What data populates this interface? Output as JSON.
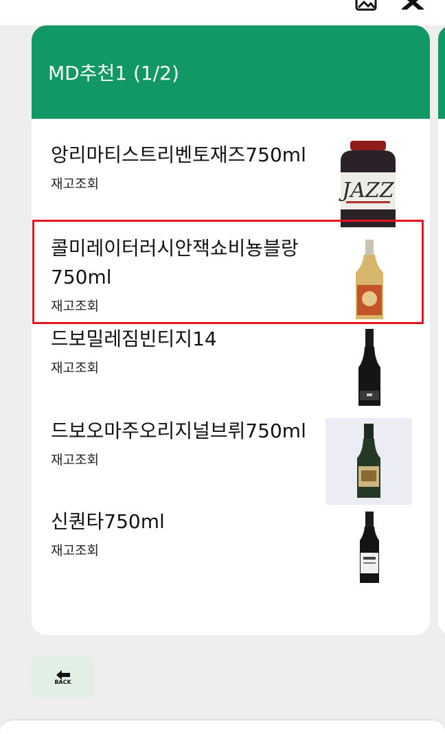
{
  "card": {
    "title": "MD추천1 (1/2)"
  },
  "products": [
    {
      "name": "앙리마티스트리벤토재즈750ml",
      "stock_label": "재고조회",
      "image": "jazz-bottle"
    },
    {
      "name": "콜미레이터러시안잭쇼비뇽블랑750ml",
      "stock_label": "재고조회",
      "image": "white-wine-bottle"
    },
    {
      "name": "드보밀레짐빈티지14",
      "stock_label": "재고조회",
      "image": "champagne-bottle-dark"
    },
    {
      "name": "드보오마주오리지널브뤼750ml",
      "stock_label": "재고조회",
      "image": "champagne-bottle-green"
    },
    {
      "name": "신퀀타750ml",
      "stock_label": "재고조회",
      "image": "red-wine-bottle"
    }
  ],
  "back_button": {
    "label": "BACK"
  },
  "colors": {
    "header": "#119864",
    "highlight": "#e8141b",
    "back_button_bg": "#e2efe4"
  }
}
